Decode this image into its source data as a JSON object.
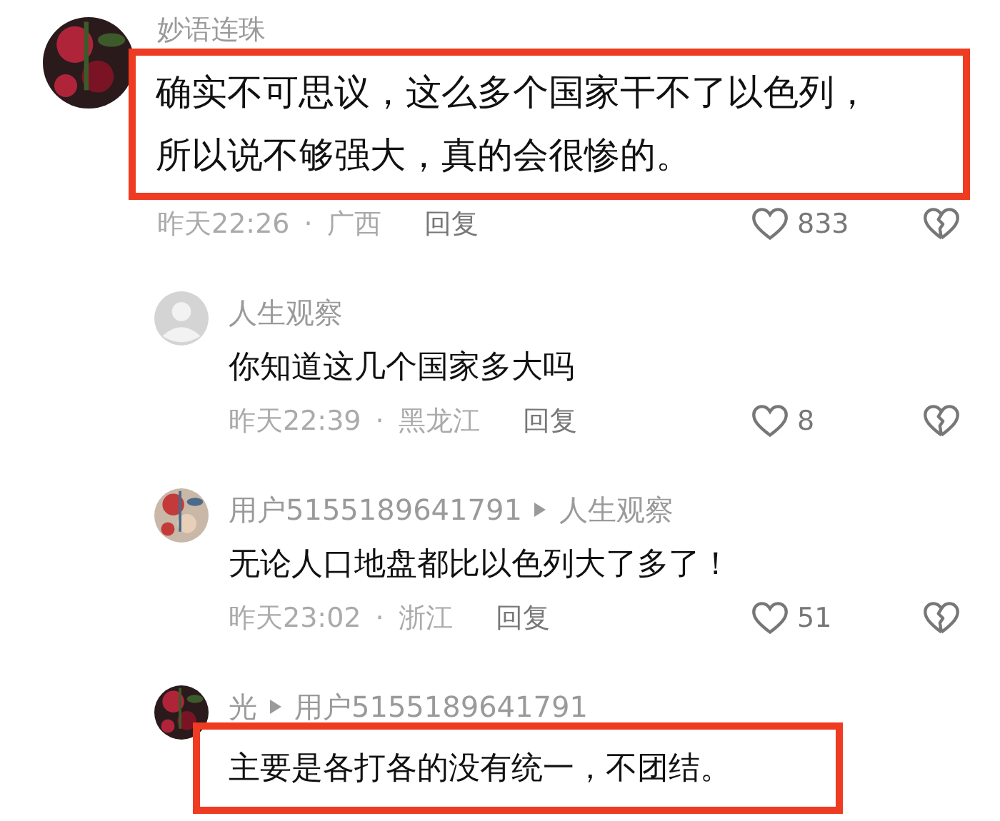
{
  "comments": [
    {
      "kind": "comment",
      "author": "妙语连珠",
      "text": "确实不可思议，这么多个国家干不了以色列，所以说不够强大，真的会很惨的。",
      "highlighted": true,
      "time": "昨天22:26",
      "separator": "·",
      "region": "广西",
      "reply_label": "回复",
      "likes": "833"
    },
    {
      "kind": "reply",
      "avatar": {
        "kind": "default"
      },
      "author": "人生观察",
      "text": "你知道这几个国家多大吗",
      "highlighted": false,
      "time": "昨天22:39",
      "separator": "·",
      "region": "黑龙江",
      "reply_label": "回复",
      "likes": "8"
    },
    {
      "kind": "reply",
      "author": "用户5155189641791",
      "reply_to": "人生观察",
      "text": "无论人口地盘都比以色列大了多了！",
      "highlighted": false,
      "time": "昨天23:02",
      "separator": "·",
      "region": "浙江",
      "reply_label": "回复",
      "likes": "51"
    },
    {
      "kind": "reply",
      "author": "光",
      "reply_to": "用户5155189641791",
      "text": "主要是各打各的没有统一，不团结。",
      "highlighted": true
    }
  ]
}
